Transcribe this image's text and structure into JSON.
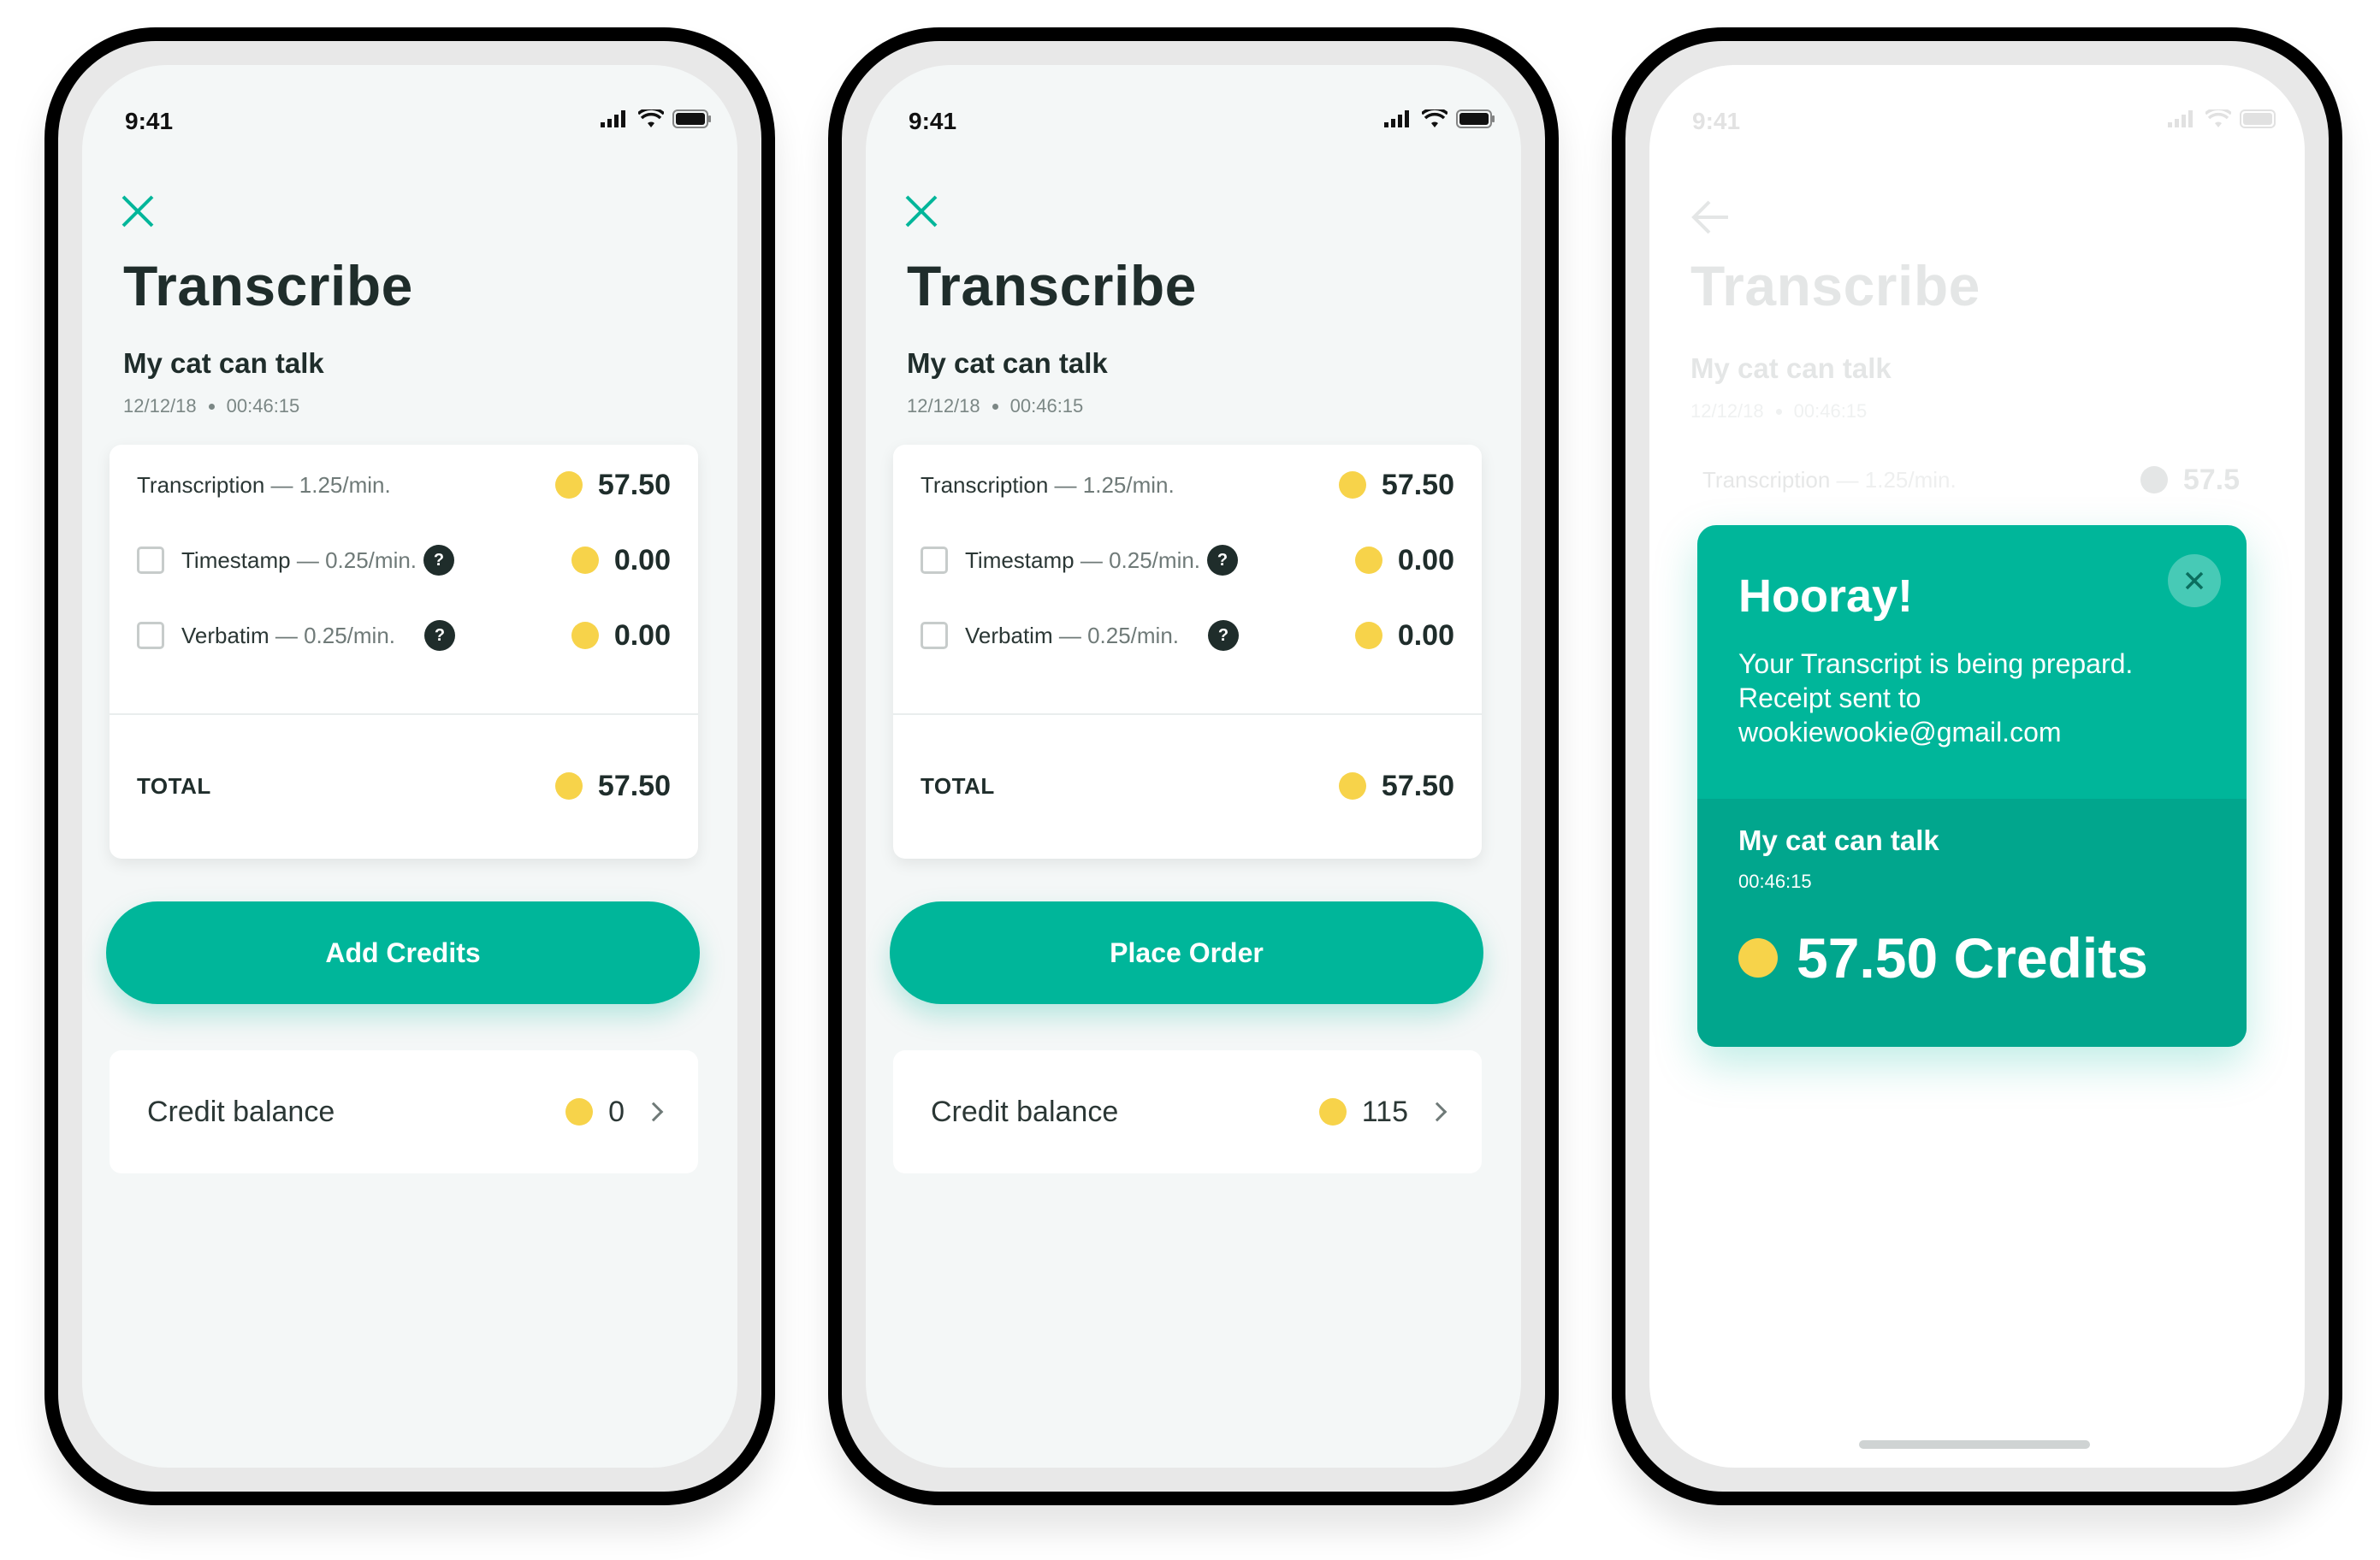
{
  "colors": {
    "accent": "#00b69a",
    "accent_dark": "#01a68d",
    "coin": "#f7d34a",
    "text": "#1f2d2b"
  },
  "status": {
    "time": "9:41"
  },
  "screens": [
    {
      "title": "Transcribe",
      "recording": {
        "name": "My cat can talk",
        "date": "12/12/18",
        "duration": "00:46:15"
      },
      "lines": [
        {
          "name": "Transcription",
          "rate": "— 1.25/min.",
          "amount": "57.50"
        },
        {
          "name": "Timestamp",
          "rate": "— 0.25/min.",
          "amount": "0.00",
          "help": "?"
        },
        {
          "name": "Verbatim",
          "rate": "— 0.25/min.",
          "amount": "0.00",
          "help": "?"
        }
      ],
      "total_label": "TOTAL",
      "total_amount": "57.50",
      "cta": "Add Credits",
      "balance_label": "Credit balance",
      "balance_value": "0"
    },
    {
      "title": "Transcribe",
      "recording": {
        "name": "My cat can talk",
        "date": "12/12/18",
        "duration": "00:46:15"
      },
      "lines": [
        {
          "name": "Transcription",
          "rate": "— 1.25/min.",
          "amount": "57.50"
        },
        {
          "name": "Timestamp",
          "rate": "— 0.25/min.",
          "amount": "0.00",
          "help": "?"
        },
        {
          "name": "Verbatim",
          "rate": "— 0.25/min.",
          "amount": "0.00",
          "help": "?"
        }
      ],
      "total_label": "TOTAL",
      "total_amount": "57.50",
      "cta": "Place Order",
      "balance_label": "Credit balance",
      "balance_value": "115"
    },
    {
      "bg_title": "Transcribe",
      "bg_recording": {
        "name": "My cat can talk",
        "date": "12/12/18",
        "duration": "00:46:15"
      },
      "bg_line": {
        "name": "Transcription",
        "rate": "— 1.25/min.",
        "amount": "57.5"
      },
      "modal": {
        "heading": "Hooray!",
        "message_1": "Your Transcript is being prepard.",
        "message_2": "Receipt sent to",
        "email": "wookiewookie@gmail.com",
        "recording_name": "My cat can talk",
        "duration": "00:46:15",
        "credits": "57.50 Credits"
      }
    }
  ]
}
